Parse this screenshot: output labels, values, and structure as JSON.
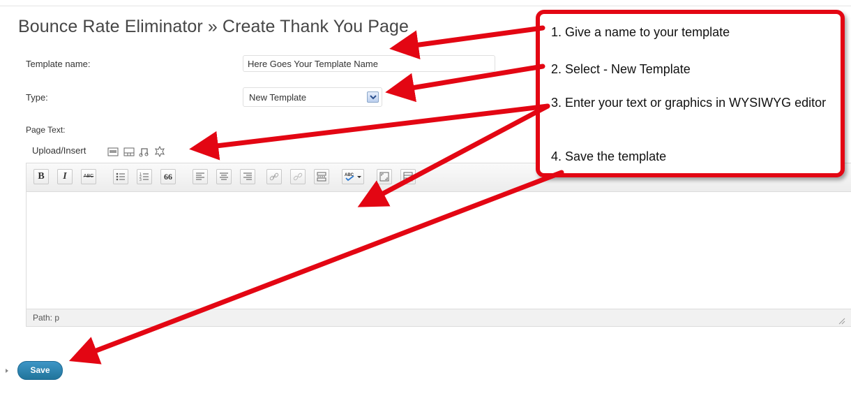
{
  "page": {
    "title": "Bounce Rate Eliminator » Create Thank You Page"
  },
  "form": {
    "template_name_label": "Template name:",
    "template_name_value": "Here Goes Your Template Name",
    "type_label": "Type:",
    "type_value": "New Template",
    "page_text_label": "Page Text:",
    "upload_insert_label": "Upload/Insert"
  },
  "editor": {
    "toolbar": [
      {
        "name": "bold-button",
        "glyph": "B"
      },
      {
        "name": "italic-button",
        "glyph": "I"
      },
      {
        "name": "strikethrough-button",
        "glyph": "ABC"
      },
      {
        "name": "bullet-list-button",
        "glyph": ""
      },
      {
        "name": "numbered-list-button",
        "glyph": ""
      },
      {
        "name": "blockquote-button",
        "glyph": "66"
      },
      {
        "name": "align-left-button",
        "glyph": ""
      },
      {
        "name": "align-center-button",
        "glyph": ""
      },
      {
        "name": "align-right-button",
        "glyph": ""
      },
      {
        "name": "insert-link-button",
        "glyph": ""
      },
      {
        "name": "unlink-button",
        "glyph": ""
      },
      {
        "name": "insert-more-button",
        "glyph": ""
      },
      {
        "name": "spellcheck-button",
        "glyph": "ABC"
      },
      {
        "name": "fullscreen-button",
        "glyph": ""
      },
      {
        "name": "kitchen-sink-button",
        "glyph": ""
      }
    ],
    "path_label": "Path: p"
  },
  "actions": {
    "save_label": "Save"
  },
  "callout": {
    "step1": "1. Give a name to your template",
    "step2": "2. Select - New Template",
    "step3": "3. Enter your text or graphics in WYSIWYG editor",
    "step4": "4. Save the template"
  },
  "colors": {
    "annotation_red": "#e30613",
    "save_blue": "#21759b"
  }
}
